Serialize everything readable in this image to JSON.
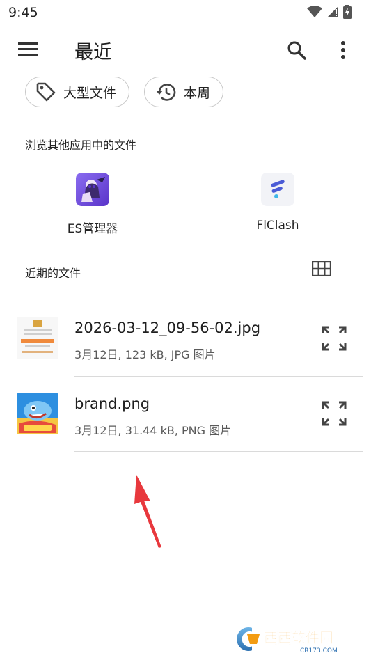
{
  "status": {
    "time": "9:45"
  },
  "appbar": {
    "title": "最近"
  },
  "chips": [
    {
      "label": "大型文件",
      "icon": "tag-icon"
    },
    {
      "label": "本周",
      "icon": "history-icon"
    }
  ],
  "browse_section": {
    "label": "浏览其他应用中的文件",
    "apps": [
      {
        "name": "ES管理器",
        "icon": "es-app-icon"
      },
      {
        "name": "FlClash",
        "icon": "flclash-app-icon"
      }
    ]
  },
  "recent_section": {
    "label": "近期的文件"
  },
  "files": [
    {
      "name": "2026-03-12_09-56-02.jpg",
      "meta": "3月12日, 123 kB, JPG 图片"
    },
    {
      "name": "brand.png",
      "meta": "3月12日, 31.44 kB, PNG 图片"
    }
  ],
  "watermark": {
    "text": "西西软件园",
    "sub": "CR173.COM"
  }
}
